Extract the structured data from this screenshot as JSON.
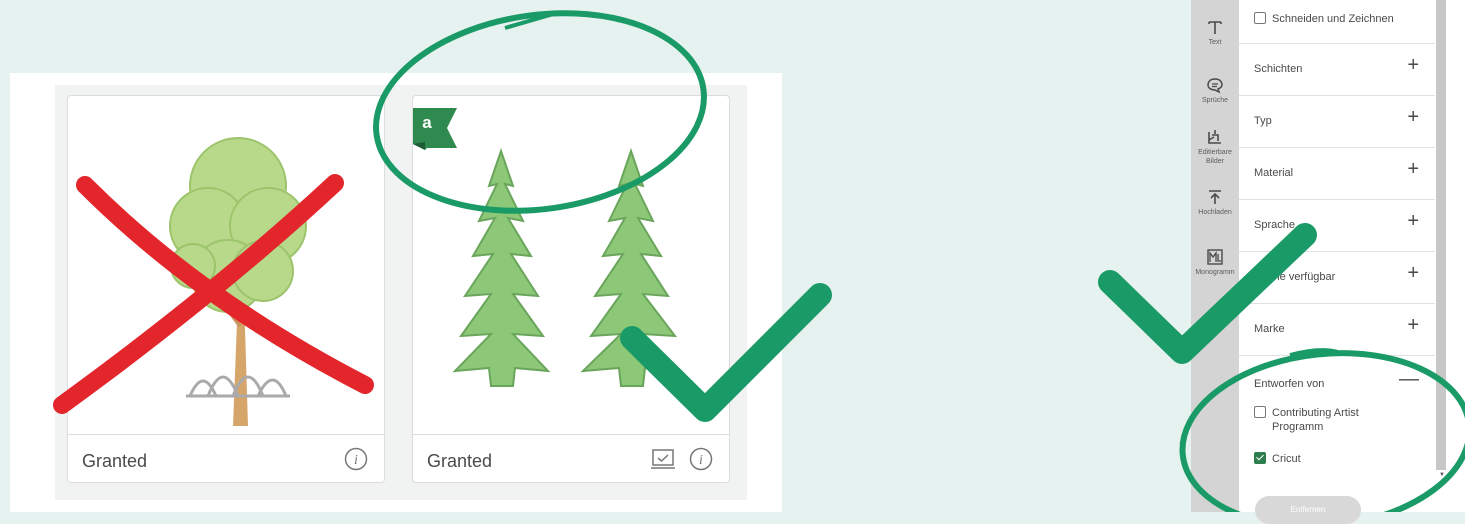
{
  "cards": [
    {
      "title": "Granted",
      "info_icon": "info-icon"
    },
    {
      "title": "Granted",
      "access_badge": "a",
      "machine_icon": "machine-compatible-icon",
      "info_icon": "info-icon"
    }
  ],
  "rail": [
    {
      "label": "Text",
      "icon": "text-icon"
    },
    {
      "label": "Sprüche",
      "icon": "speech-bubble-icon"
    },
    {
      "label": "Editierbare Bilder",
      "icon": "editable-image-icon"
    },
    {
      "label": "Hochladen",
      "icon": "upload-icon"
    },
    {
      "label": "Monogramm",
      "icon": "monogram-icon"
    }
  ],
  "filters": {
    "cut_and_draw": "Schneiden und Zeichnen",
    "sections": [
      {
        "label": "Schichten",
        "toggle": "+"
      },
      {
        "label": "Typ",
        "toggle": "+"
      },
      {
        "label": "Material",
        "toggle": "+"
      },
      {
        "label": "Sprache",
        "toggle": "+"
      },
      {
        "label": "Online verfügbar",
        "toggle": "+"
      },
      {
        "label": "Marke",
        "toggle": "+"
      },
      {
        "label": "Entworfen von",
        "toggle": "—"
      }
    ],
    "designed_by_options": [
      {
        "label": "Contributing Artist",
        "label2": "Programm",
        "checked": false
      },
      {
        "label": "Cricut",
        "checked": true
      }
    ],
    "remove_label": "Entfernen"
  },
  "colors": {
    "background": "#e6f2ef",
    "annotation_green": "#1a9a66",
    "annotation_red": "#e3262b",
    "tree_green": "#8cc878"
  }
}
